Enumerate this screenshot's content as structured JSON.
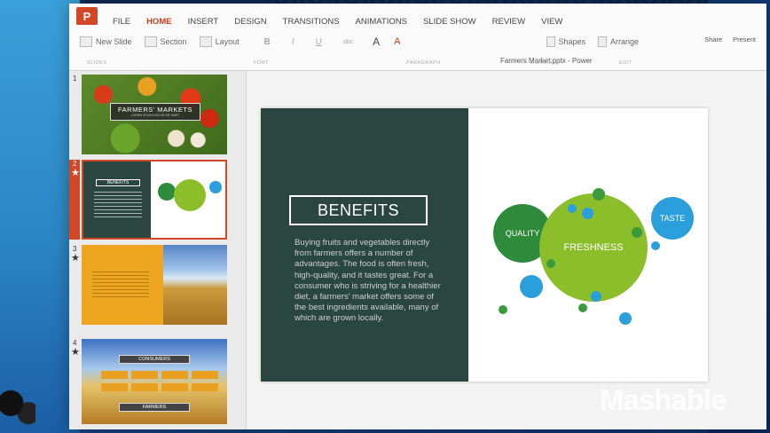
{
  "ribbon": {
    "tabs": [
      {
        "label": "FILE"
      },
      {
        "label": "HOME",
        "active": true
      },
      {
        "label": "INSERT"
      },
      {
        "label": "DESIGN"
      },
      {
        "label": "TRANSITIONS"
      },
      {
        "label": "ANIMATIONS"
      },
      {
        "label": "SLIDE SHOW"
      },
      {
        "label": "REVIEW"
      },
      {
        "label": "VIEW"
      }
    ],
    "file_title": "Farmers Market.pptx - Power",
    "new_slide": "New Slide",
    "section": "Section",
    "layout": "Layout",
    "bold": "B",
    "italic": "I",
    "underline": "U",
    "strike": "abc",
    "font_size": "A",
    "font_color": "A",
    "shapes": "Shapes",
    "arrange": "Arrange",
    "share": "Share",
    "present": "Present",
    "groups": {
      "slides": "SLIDES",
      "font": "FONT",
      "paragraph": "PARAGRAPH",
      "drawing": "DRAWING",
      "edit": "EDIT"
    },
    "accent": "#c43e1c"
  },
  "thumbnails": [
    {
      "number": "1",
      "title": "FARMERS' MARKETS",
      "subtitle": "LOREM IPSUM DOLOR SIT AMET"
    },
    {
      "number": "2",
      "title": "BENEFITS",
      "starred": true,
      "selected": true
    },
    {
      "number": "3",
      "starred": true
    },
    {
      "number": "4",
      "starred": true,
      "title": "CONSUMERS",
      "footer": "FARMERS"
    }
  ],
  "slide": {
    "title": "BENEFITS",
    "body": "Buying fruits and vegetables directly from farmers offers a number of advantages. The food is often fresh, high-quality, and it tastes great.  For a consumer who is striving for a healthier diet, a farmers' market offers some of the best ingredients available, many of which are grown locally.",
    "bubbles": [
      {
        "label": "QUALITY",
        "color": "#2e8b3c"
      },
      {
        "label": "FRESHNESS",
        "color": "#8cbd2a"
      },
      {
        "label": "TASTE",
        "color": "#2a9fdc"
      }
    ],
    "bg_dark": "#2b4640"
  },
  "watermark": "Mashable"
}
